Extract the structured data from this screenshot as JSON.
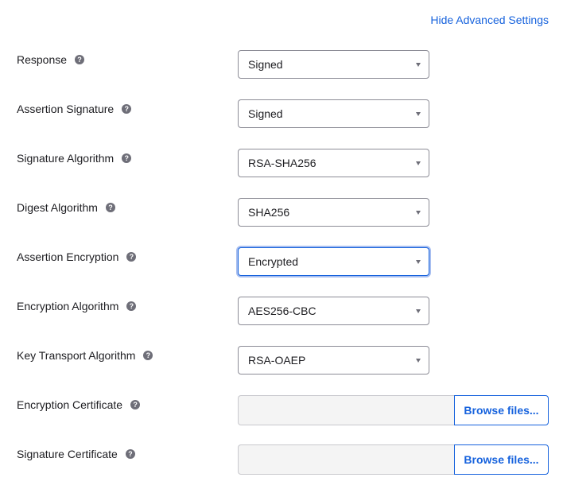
{
  "header": {
    "hide_advanced_label": "Hide Advanced Settings"
  },
  "help_glyph": "?",
  "fields": [
    {
      "label": "Response",
      "value": "Signed"
    },
    {
      "label": "Assertion Signature",
      "value": "Signed"
    },
    {
      "label": "Signature Algorithm",
      "value": "RSA-SHA256"
    },
    {
      "label": "Digest Algorithm",
      "value": "SHA256"
    },
    {
      "label": "Assertion Encryption",
      "value": "Encrypted"
    },
    {
      "label": "Encryption Algorithm",
      "value": "AES256-CBC"
    },
    {
      "label": "Key Transport Algorithm",
      "value": "RSA-OAEP"
    }
  ],
  "certificates": [
    {
      "label": "Encryption Certificate",
      "button_label": "Browse files..."
    },
    {
      "label": "Signature Certificate",
      "button_label": "Browse files..."
    }
  ],
  "colors": {
    "link": "#1662dd",
    "focus_ring": "#a7bef0",
    "help_icon": "#6e6e78"
  }
}
